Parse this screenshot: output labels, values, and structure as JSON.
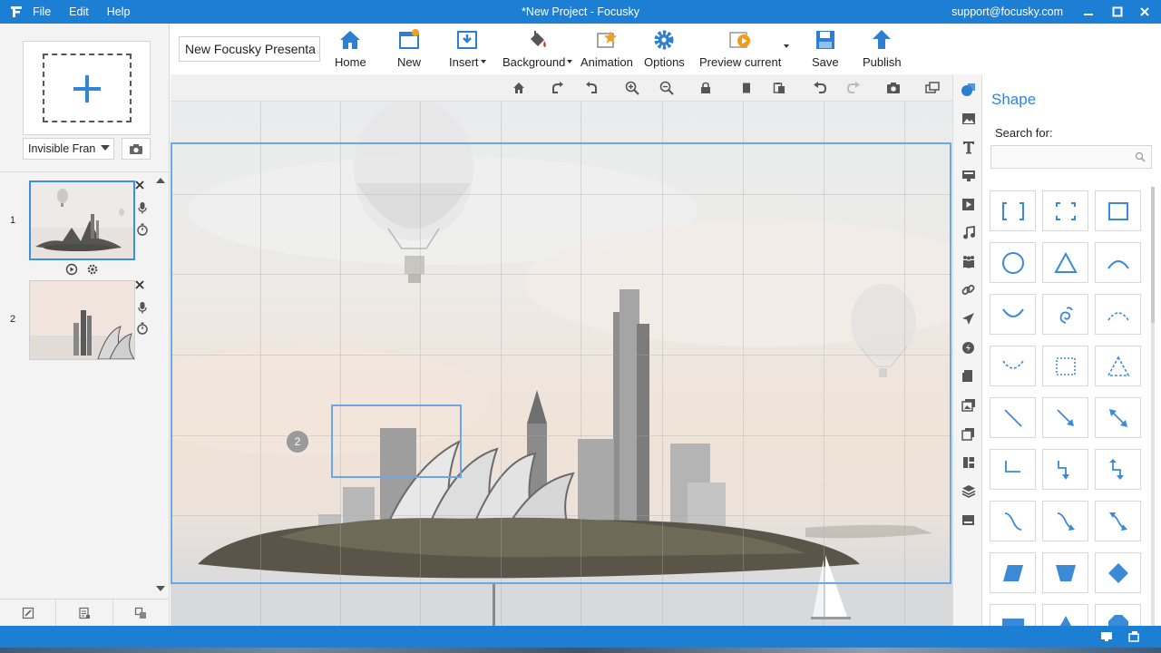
{
  "window": {
    "title": "*New Project - Focusky",
    "support_email": "support@focusky.com",
    "menu": [
      "File",
      "Edit",
      "Help"
    ]
  },
  "left_panel": {
    "frame_type": "Invisible Fran",
    "slides": [
      {
        "number": "1",
        "active": true
      },
      {
        "number": "2",
        "active": false
      }
    ]
  },
  "toolbar": {
    "project_name": "New Focusky Presenta",
    "buttons": {
      "home": "Home",
      "new": "New",
      "insert": "Insert",
      "background": "Background",
      "animation": "Animation",
      "options": "Options",
      "preview": "Preview current",
      "save": "Save",
      "publish": "Publish"
    }
  },
  "canvas": {
    "frame_badge": "2"
  },
  "shape_panel": {
    "title": "Shape",
    "search_label": "Search for:",
    "search_value": ""
  },
  "colors": {
    "accent": "#1c7fd3",
    "shape_blue": "#4a90d9",
    "frame_border": "#6aa6e8"
  }
}
